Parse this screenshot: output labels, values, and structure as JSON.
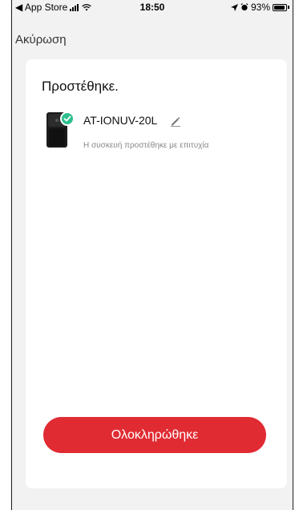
{
  "status_bar": {
    "back_app": "◀ App Store",
    "time": "18:50",
    "battery_percent": "93%",
    "battery_level": 0.93
  },
  "nav": {
    "cancel_label": "Ακύρωση"
  },
  "card": {
    "title": "Προστέθηκε.",
    "device": {
      "name": "AT-IONUV-20L",
      "status": "Η συσκευή προστέθηκε με επιτυχία",
      "image_icon": "air-purifier-device-icon",
      "badge_icon": "check-icon",
      "edit_icon": "pencil-icon"
    },
    "done_label": "Ολοκληρώθηκε"
  },
  "colors": {
    "accent": "#e02b33",
    "success": "#2fbf8f",
    "background": "#f2f2f2",
    "card": "#ffffff"
  }
}
